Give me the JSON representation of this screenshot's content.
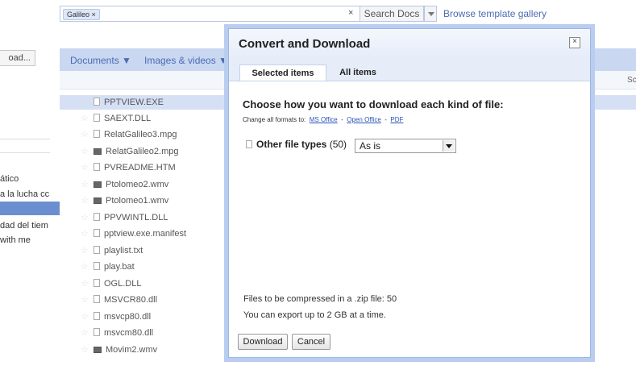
{
  "search": {
    "token": "Galileo ×",
    "clear": "×",
    "button": "Search Docs",
    "gallery_link": "Browse template gallery"
  },
  "sidebar": {
    "upload_label": "oad...",
    "items": [
      "ático",
      "a la lucha cc",
      "dad del tiem",
      "with me"
    ]
  },
  "toolbar": {
    "documents": "Documents ▼",
    "images_videos": "Images & videos ▼",
    "col_partial": "Sc"
  },
  "files": [
    {
      "name": "PPTVIEW.EXE",
      "icon": "file-icon"
    },
    {
      "name": "SAEXT.DLL",
      "icon": "file-icon"
    },
    {
      "name": "RelatGalileo3.mpg",
      "icon": "file-icon"
    },
    {
      "name": "RelatGalileo2.mpg",
      "icon": "video-icon"
    },
    {
      "name": "PVREADME.HTM",
      "icon": "file-icon"
    },
    {
      "name": "Ptolomeo2.wmv",
      "icon": "video-icon"
    },
    {
      "name": "Ptolomeo1.wmv",
      "icon": "video-icon"
    },
    {
      "name": "PPVWINTL.DLL",
      "icon": "file-icon"
    },
    {
      "name": "pptview.exe.manifest",
      "icon": "file-icon"
    },
    {
      "name": "playlist.txt",
      "icon": "file-icon"
    },
    {
      "name": "play.bat",
      "icon": "file-icon"
    },
    {
      "name": "OGL.DLL",
      "icon": "file-icon"
    },
    {
      "name": "MSVCR80.dll",
      "icon": "file-icon"
    },
    {
      "name": "msvcp80.dll",
      "icon": "file-icon"
    },
    {
      "name": "msvcm80.dll",
      "icon": "file-icon"
    },
    {
      "name": "Movim2.wmv",
      "icon": "video-icon"
    }
  ],
  "dialog": {
    "title": "Convert and Download",
    "close": "×",
    "tabs": [
      "Selected items",
      "All items"
    ],
    "heading": "Choose how you want to download each kind of file:",
    "change_prefix": "Change all formats to:",
    "formats": [
      "MS Office",
      "Open Office",
      "PDF"
    ],
    "format_sep": "-",
    "other_label": "Other file types",
    "other_count": "(50)",
    "select_value": "As is",
    "zip_info": "Files to be compressed in a .zip file: 50",
    "export_info": "You can export up to 2 GB at a time.",
    "download_btn": "Download",
    "cancel_btn": "Cancel"
  },
  "colors": {
    "accent": "#c9d7f1",
    "link": "#4c6cb3",
    "selected": "#6b8ed0"
  }
}
